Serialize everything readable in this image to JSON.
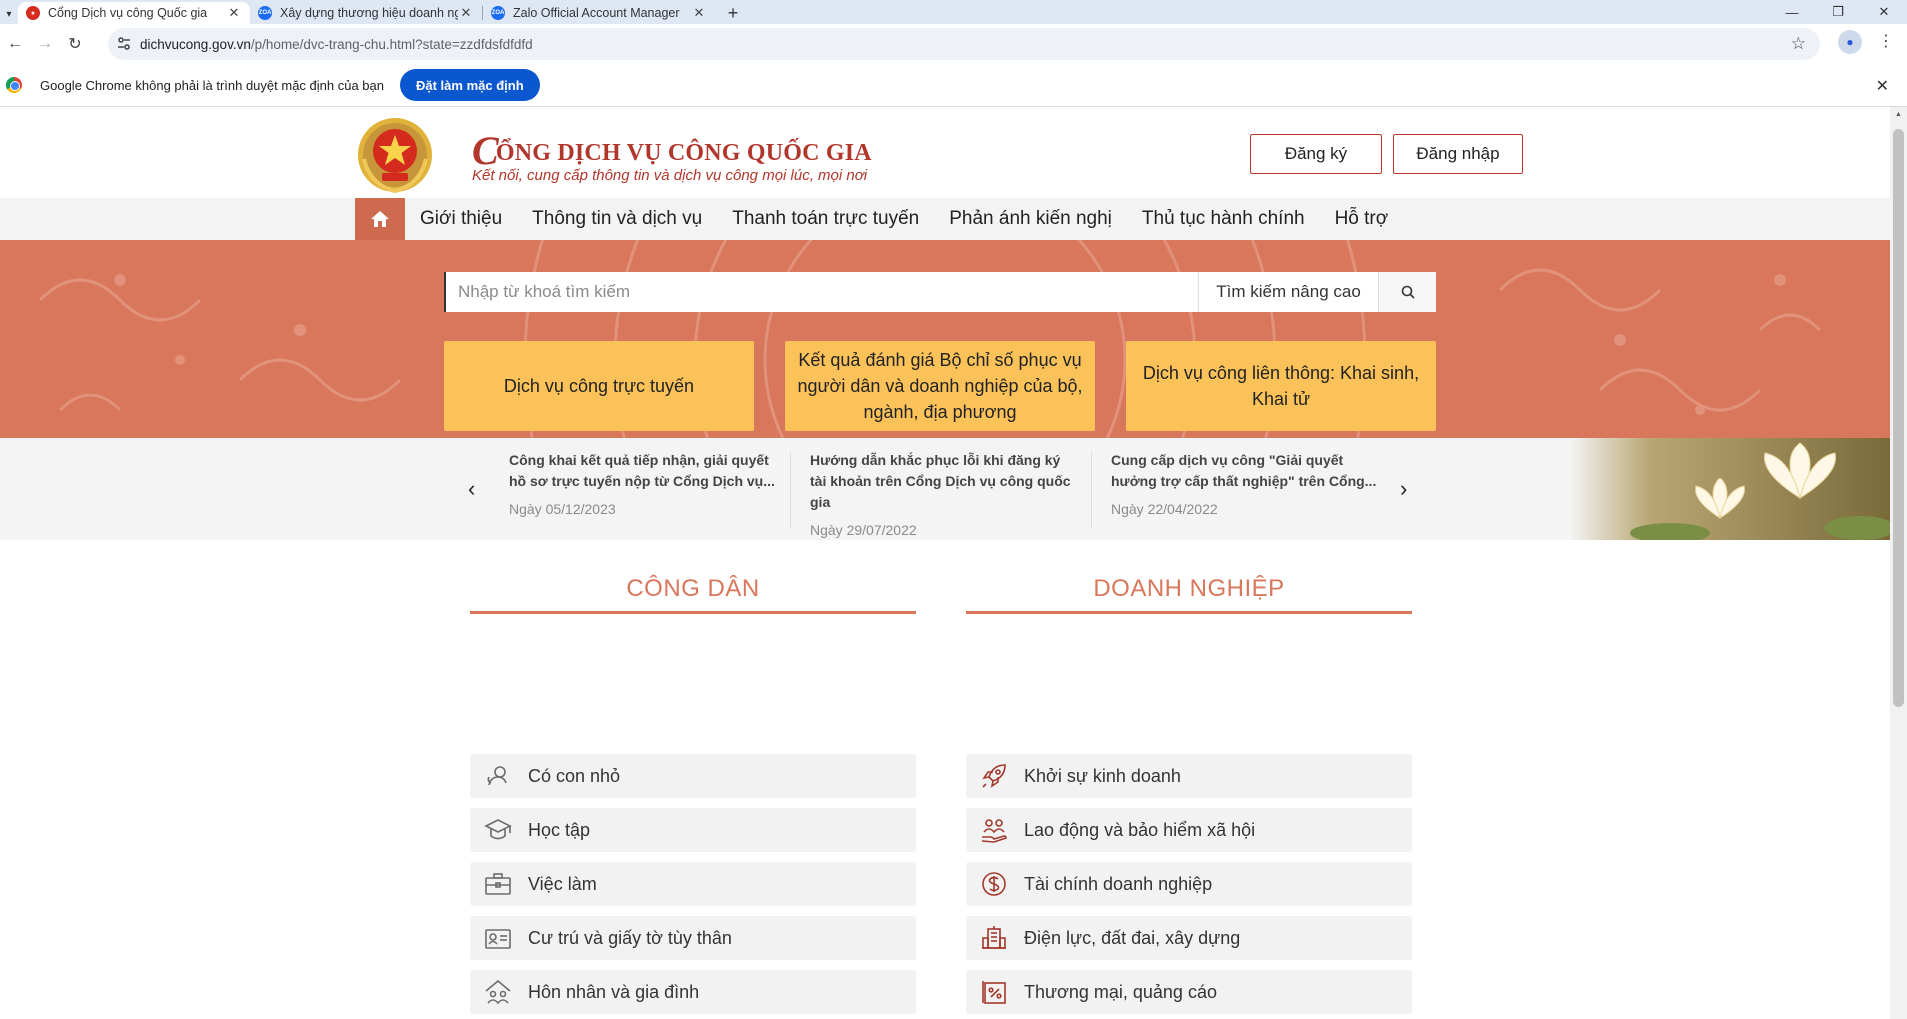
{
  "browser": {
    "tabs": [
      {
        "title": "Cổng Dịch vụ công Quốc gia",
        "active": true
      },
      {
        "title": "Xây dựng thương hiệu doanh nghiệp",
        "active": false
      },
      {
        "title": "Zalo Official Account Manager",
        "active": false
      }
    ],
    "favicon_zoa_text": "ZOA",
    "url_host": "dichvucong.gov.vn",
    "url_path": "/p/home/dvc-trang-chu.html?state=zzdfdsfdfdfd",
    "infobar_message": "Google Chrome không phải là trình duyệt mặc định của bạn",
    "infobar_button": "Đặt làm mặc định"
  },
  "header": {
    "title_cap": "C",
    "title_rest": "ỔNG DỊCH VỤ CÔNG QUỐC GIA",
    "subtitle": "Kết nối, cung cấp thông tin và dịch vụ công mọi lúc, mọi nơi",
    "register": "Đăng ký",
    "login": "Đăng nhập"
  },
  "nav": {
    "items": [
      "Giới thiệu",
      "Thông tin và dịch vụ",
      "Thanh toán trực tuyến",
      "Phản ánh kiến nghị",
      "Thủ tục hành chính",
      "Hỗ trợ"
    ]
  },
  "search": {
    "placeholder": "Nhập từ khoá tìm kiếm",
    "advanced": "Tìm kiếm nâng cao"
  },
  "quick_links": [
    "Dịch vụ công trực tuyến",
    "Kết quả đánh giá Bộ chỉ số phục vụ người dân và doanh nghiệp của bộ, ngành, địa phương",
    "Dịch vụ công liên thông: Khai sinh, Khai tử"
  ],
  "news": [
    {
      "title": "Công khai kết quả tiếp nhận, giải quyết hồ sơ trực tuyến nộp từ Cổng Dịch vụ...",
      "date": "Ngày 05/12/2023"
    },
    {
      "title": "Hướng dẫn khắc phục lỗi khi đăng ký tài khoản trên Cổng Dịch vụ công quốc gia",
      "date": "Ngày 29/07/2022"
    },
    {
      "title": "Cung cấp dịch vụ công \"Giải quyết hưởng trợ cấp thất nghiệp\" trên Cổng...",
      "date": "Ngày 22/04/2022"
    }
  ],
  "citizen": {
    "title": "CÔNG DÂN",
    "items": [
      {
        "label": "Có con nhỏ",
        "icon": "baby-icon"
      },
      {
        "label": "Học tập",
        "icon": "graduation-cap-icon"
      },
      {
        "label": "Việc làm",
        "icon": "briefcase-icon"
      },
      {
        "label": "Cư trú và giấy tờ tùy thân",
        "icon": "id-card-icon"
      },
      {
        "label": "Hôn nhân và gia đình",
        "icon": "family-home-icon"
      }
    ]
  },
  "business": {
    "title": "DOANH NGHIỆP",
    "items": [
      {
        "label": "Khởi sự kinh doanh",
        "icon": "rocket-icon"
      },
      {
        "label": "Lao động và bảo hiểm xã hội",
        "icon": "workers-hand-icon"
      },
      {
        "label": "Tài chính doanh nghiệp",
        "icon": "dollar-coin-icon"
      },
      {
        "label": "Điện lực, đất đai, xây dựng",
        "icon": "building-icon"
      },
      {
        "label": "Thương mại, quảng cáo",
        "icon": "percent-tag-icon"
      }
    ]
  },
  "colors": {
    "brand_red": "#b1362b",
    "accent": "#d9775d",
    "quick_yellow": "#fcc25a"
  }
}
